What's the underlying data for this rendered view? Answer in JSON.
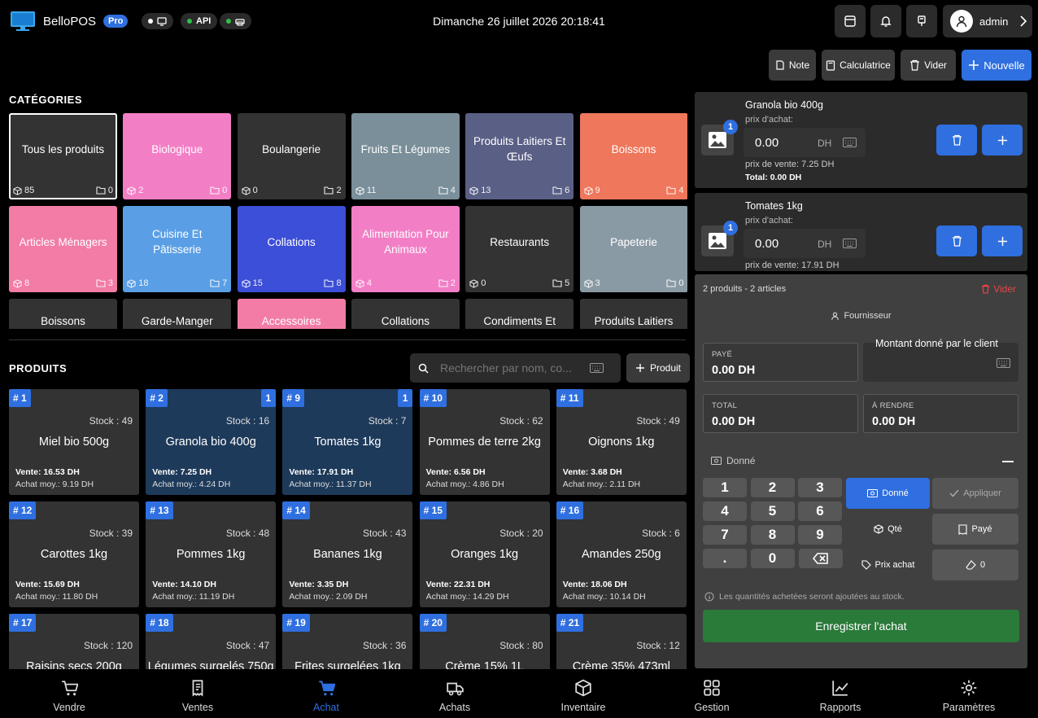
{
  "header": {
    "app_name": "BelloPOS",
    "badge": "Pro",
    "api_label": "API",
    "datetime": "Dimanche 26 juillet 2026  20:18:41",
    "user": "admin"
  },
  "actions": {
    "note": "Note",
    "calculator": "Calculatrice",
    "clear": "Vider",
    "new": "Nouvelle"
  },
  "categories": {
    "title": "CATÉGORIES",
    "items": [
      {
        "name": "Tous les produits",
        "products": "85",
        "subs": "0",
        "color": "#333333"
      },
      {
        "name": "Biologique",
        "products": "2",
        "subs": "0",
        "color": "#f27fc6"
      },
      {
        "name": "Boulangerie",
        "products": "0",
        "subs": "2",
        "color": "#333333"
      },
      {
        "name": "Fruits Et Légumes",
        "products": "11",
        "subs": "4",
        "color": "#7a8f9a"
      },
      {
        "name": "Produits Laitiers Et Œufs",
        "products": "13",
        "subs": "6",
        "color": "#5a5f86"
      },
      {
        "name": "Boissons",
        "products": "9",
        "subs": "4",
        "color": "#ee775c"
      },
      {
        "name": "Articles Ménagers",
        "products": "8",
        "subs": "3",
        "color": "#f27ca6"
      },
      {
        "name": "Cuisine Et Pâtisserie",
        "products": "18",
        "subs": "7",
        "color": "#5a9fe5"
      },
      {
        "name": "Collations",
        "products": "15",
        "subs": "8",
        "color": "#3c4fd8"
      },
      {
        "name": "Alimentation Pour Animaux",
        "products": "4",
        "subs": "2",
        "color": "#f27fc6"
      },
      {
        "name": "Restaurants",
        "products": "0",
        "subs": "5",
        "color": "#333333"
      },
      {
        "name": "Papeterie",
        "products": "3",
        "subs": "0",
        "color": "#8a9aa5"
      },
      {
        "name": "Boissons",
        "products": "",
        "subs": "",
        "color": "#333333"
      },
      {
        "name": "Garde-Manger",
        "products": "",
        "subs": "",
        "color": "#333333"
      },
      {
        "name": "Accessoires",
        "products": "",
        "subs": "",
        "color": "#f27ca6"
      },
      {
        "name": "Collations",
        "products": "",
        "subs": "",
        "color": "#333333"
      },
      {
        "name": "Condiments Et",
        "products": "",
        "subs": "",
        "color": "#333333"
      },
      {
        "name": "Produits Laitiers",
        "products": "",
        "subs": "",
        "color": "#333333"
      }
    ]
  },
  "products": {
    "title": "PRODUITS",
    "search_placeholder": "Rechercher par nom, co...",
    "add_label": "Produit",
    "items": [
      {
        "num": "# 1",
        "qty": "",
        "stock": "Stock : 49",
        "name": "Miel bio 500g",
        "sale": "Vente: 16.53 DH",
        "avg": "Achat moy.: 9.19 DH"
      },
      {
        "num": "# 2",
        "qty": "1",
        "stock": "Stock : 16",
        "name": "Granola bio 400g",
        "sale": "Vente: 7.25 DH",
        "avg": "Achat moy.: 4.24 DH"
      },
      {
        "num": "# 9",
        "qty": "1",
        "stock": "Stock : 7",
        "name": "Tomates 1kg",
        "sale": "Vente: 17.91 DH",
        "avg": "Achat moy.: 11.37 DH"
      },
      {
        "num": "# 10",
        "qty": "",
        "stock": "Stock : 62",
        "name": "Pommes de terre 2kg",
        "sale": "Vente: 6.56 DH",
        "avg": "Achat moy.: 4.86 DH"
      },
      {
        "num": "# 11",
        "qty": "",
        "stock": "Stock : 49",
        "name": "Oignons 1kg",
        "sale": "Vente: 3.68 DH",
        "avg": "Achat moy.: 2.11 DH"
      },
      {
        "num": "# 12",
        "qty": "",
        "stock": "Stock : 39",
        "name": "Carottes 1kg",
        "sale": "Vente: 15.69 DH",
        "avg": "Achat moy.: 11.80 DH"
      },
      {
        "num": "# 13",
        "qty": "",
        "stock": "Stock : 48",
        "name": "Pommes 1kg",
        "sale": "Vente: 14.10 DH",
        "avg": "Achat moy.: 11.19 DH"
      },
      {
        "num": "# 14",
        "qty": "",
        "stock": "Stock : 43",
        "name": "Bananes 1kg",
        "sale": "Vente: 3.35 DH",
        "avg": "Achat moy.: 2.09 DH"
      },
      {
        "num": "# 15",
        "qty": "",
        "stock": "Stock : 20",
        "name": "Oranges 1kg",
        "sale": "Vente: 22.31 DH",
        "avg": "Achat moy.: 14.29 DH"
      },
      {
        "num": "# 16",
        "qty": "",
        "stock": "Stock : 6",
        "name": "Amandes 250g",
        "sale": "Vente: 18.06 DH",
        "avg": "Achat moy.: 10.14 DH"
      },
      {
        "num": "# 17",
        "qty": "",
        "stock": "Stock : 120",
        "name": "Raisins secs 200g",
        "sale": "",
        "avg": ""
      },
      {
        "num": "# 18",
        "qty": "",
        "stock": "Stock : 47",
        "name": "Légumes surgelés 750g",
        "sale": "",
        "avg": ""
      },
      {
        "num": "# 19",
        "qty": "",
        "stock": "Stock : 36",
        "name": "Frites surgelées 1kg",
        "sale": "",
        "avg": ""
      },
      {
        "num": "# 20",
        "qty": "",
        "stock": "Stock : 80",
        "name": "Crème 15% 1L",
        "sale": "",
        "avg": ""
      },
      {
        "num": "# 21",
        "qty": "",
        "stock": "Stock : 12",
        "name": "Crème 35% 473ml",
        "sale": "",
        "avg": ""
      }
    ]
  },
  "cart": {
    "items": [
      {
        "name": "Granola bio 400g",
        "qty": "1",
        "price_label": "prix d'achat:",
        "price": "0.00",
        "unit": "DH",
        "sale": "prix de vente: 7.25 DH",
        "total": "Total: 0.00 DH"
      },
      {
        "name": "Tomates 1kg",
        "qty": "1",
        "price_label": "prix d'achat:",
        "price": "0.00",
        "unit": "DH",
        "sale": "prix de vente: 17.91 DH",
        "total": ""
      }
    ]
  },
  "payment": {
    "summary": "2 produits - 2 articles",
    "clear": "Vider",
    "supplier": "Fournisseur",
    "paid_label": "PAYÉ",
    "paid_value": "0.00 DH",
    "given_label": "Montant donné par le client",
    "total_label": "TOTAL",
    "total_value": "0.00 DH",
    "change_label": "À RENDRE",
    "change_value": "0.00 DH",
    "donne_label": "Donné",
    "keys": [
      "1",
      "2",
      "3",
      "4",
      "5",
      "6",
      "7",
      "8",
      "9",
      ".",
      "0"
    ],
    "btn_donne": "Donné",
    "btn_apply": "Appliquer",
    "btn_qty": "Qté",
    "btn_paid": "Payé",
    "btn_price": "Prix achat",
    "btn_zero": "0",
    "info": "Les quantités achetées seront ajoutées au stock.",
    "register": "Enregistrer l'achat"
  },
  "nav": [
    {
      "label": "Vendre",
      "icon": "cart-icon"
    },
    {
      "label": "Ventes",
      "icon": "receipt-icon"
    },
    {
      "label": "Achat",
      "icon": "basket-icon"
    },
    {
      "label": "Achats",
      "icon": "truck-icon"
    },
    {
      "label": "Inventaire",
      "icon": "box-icon"
    },
    {
      "label": "Gestion",
      "icon": "grid-icon"
    },
    {
      "label": "Rapports",
      "icon": "chart-icon"
    },
    {
      "label": "Paramètres",
      "icon": "gear-icon"
    }
  ],
  "colors": {
    "accent": "#2f6fe0",
    "success": "#2a7a3a",
    "danger": "#e84545"
  }
}
